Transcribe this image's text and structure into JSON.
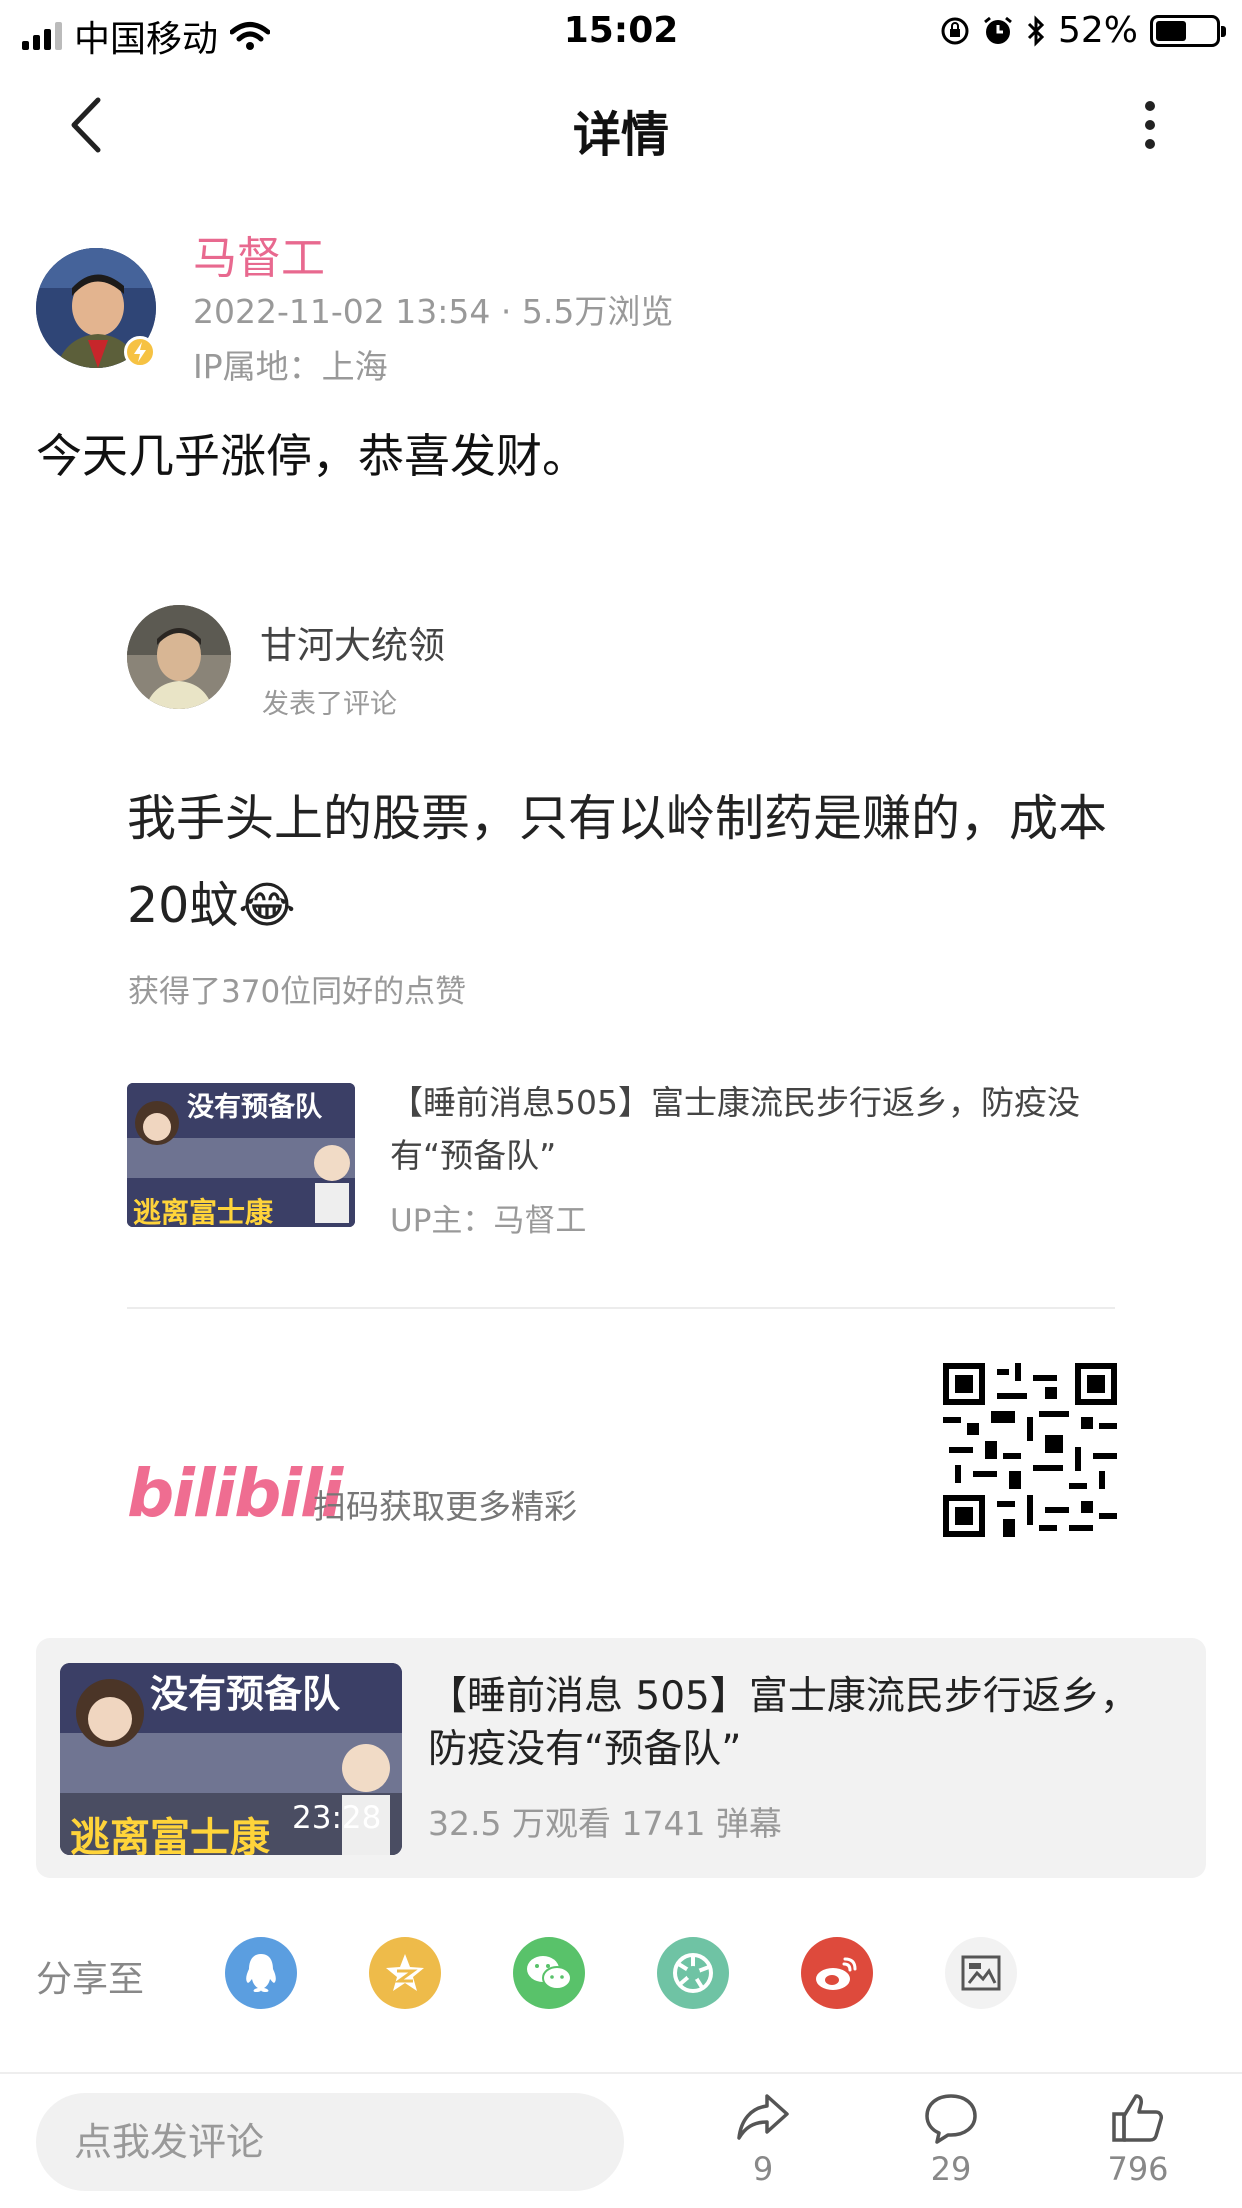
{
  "status_bar": {
    "carrier": "中国移动",
    "time": "15:02",
    "battery": "52%",
    "battery_level": 0.52
  },
  "nav": {
    "title": "详情",
    "back_icon": "back-chevron-icon",
    "more_icon": "more-vertical-icon"
  },
  "post": {
    "author": "马督工",
    "meta": "2022-11-02 13:54 · 5.5万浏览",
    "ip": "IP属地：上海",
    "text": "今天几乎涨停，恭喜发财。"
  },
  "comment": {
    "user": "甘河大统领",
    "action": "发表了评论",
    "text": "我手头上的股票，只有以岭制药是赚的，成本20蚊😂",
    "likes": "获得了370位同好的点赞",
    "video_title": "【睡前消息505】富士康流民步行返乡，防疫没有“预备队”",
    "video_up": "UP主：马督工",
    "thumb_top_text": "没有预备队",
    "thumb_bottom_text": "逃离富士康",
    "brand": "bilibili",
    "scan_tip": "扫码获取更多精彩"
  },
  "video_card": {
    "title": "【睡前消息 505】富士康流民步行返乡，防疫没有“预备队”",
    "stats": "32.5 万观看 1741 弹幕",
    "duration": "23:28",
    "thumb_top_text": "没有预备队",
    "thumb_bottom_text": "逃离富士康"
  },
  "share": {
    "label": "分享至",
    "targets": [
      {
        "icon": "qq-icon",
        "color": "#5b9ee0"
      },
      {
        "icon": "qzone-icon",
        "color": "#eebb4a"
      },
      {
        "icon": "wechat-icon",
        "color": "#59c26a"
      },
      {
        "icon": "moments-icon",
        "color": "#6fc3a4"
      },
      {
        "icon": "weibo-icon",
        "color": "#de4a3c"
      },
      {
        "icon": "image-icon",
        "color": "#f2f2f2"
      }
    ]
  },
  "bottom_bar": {
    "comment_placeholder": "点我发评论",
    "share_count": "9",
    "comment_count": "29",
    "like_count": "796"
  }
}
